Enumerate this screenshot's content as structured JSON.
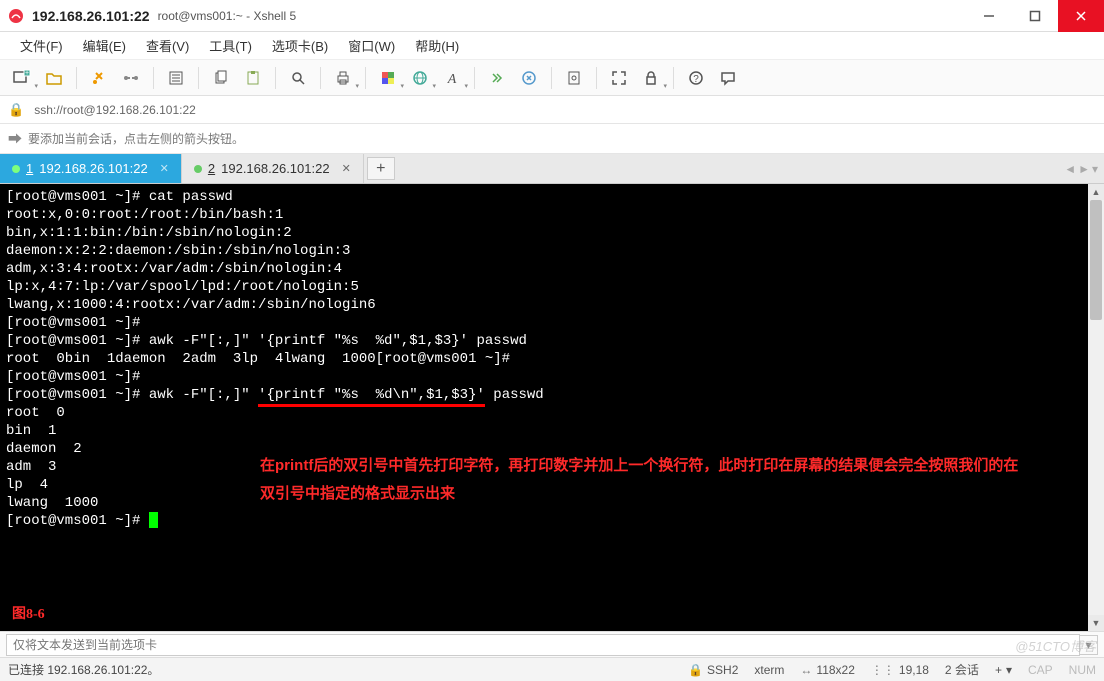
{
  "window": {
    "title": "192.168.26.101:22",
    "subtitle": "root@vms001:~ - Xshell 5"
  },
  "menu": {
    "file": "文件(F)",
    "edit": "编辑(E)",
    "view": "查看(V)",
    "tools": "工具(T)",
    "tab": "选项卡(B)",
    "window": "窗口(W)",
    "help": "帮助(H)"
  },
  "address": "ssh://root@192.168.26.101:22",
  "hint": "要添加当前会话，点击左侧的箭头按钮。",
  "tabs": [
    {
      "num": "1",
      "label": "192.168.26.101:22",
      "active": true
    },
    {
      "num": "2",
      "label": "192.168.26.101:22",
      "active": false
    }
  ],
  "term": {
    "l01": "[root@vms001 ~]# cat passwd",
    "l02": "root:x,0:0:root:/root:/bin/bash:1",
    "l03": "bin,x:1:1:bin:/bin:/sbin/nologin:2",
    "l04": "daemon:x:2:2:daemon:/sbin:/sbin/nologin:3",
    "l05": "adm,x:3:4:rootx:/var/adm:/sbin/nologin:4",
    "l06": "lp:x,4:7:lp:/var/spool/lpd:/root/nologin:5",
    "l07": "lwang,x:1000:4:rootx:/var/adm:/sbin/nologin6",
    "l08": "[root@vms001 ~]#",
    "l09": "[root@vms001 ~]# awk -F\"[:,]\" '{printf \"%s  %d\",$1,$3}' passwd",
    "l10": "root  0bin  1daemon  2adm  3lp  4lwang  1000[root@vms001 ~]#",
    "l11": "[root@vms001 ~]#",
    "l12a": "[root@vms001 ~]# awk -F\"[:,]\" ",
    "l12b": "'{printf \"%s  %d\\n\",$1,$3}'",
    "l12c": " passwd",
    "l13": "root  0",
    "l14": "bin  1",
    "l15": "daemon  2",
    "l16": "adm  3",
    "l17": "lp  4",
    "l18": "lwang  1000",
    "l19": "[root@vms001 ~]# "
  },
  "annotation": "在printf后的双引号中首先打印字符，再打印数字并加上一个换行符，此时打印在屏幕的结果便会完全按照我们的在双引号中指定的格式显示出来",
  "figure_label": "图8-6",
  "bottom_placeholder": "仅将文本发送到当前选项卡",
  "status": {
    "conn": "已连接 192.168.26.101:22。",
    "proto": "SSH2",
    "termtype": "xterm",
    "size": "118x22",
    "pos": "19,18",
    "sessions": "2 会话"
  },
  "watermark": "@51CTO博客",
  "icons": {
    "size_arrows": "↔",
    "pos_dots": "⋮⋮",
    "plus": "+",
    "caps": "CAP",
    "num": "NUM"
  }
}
